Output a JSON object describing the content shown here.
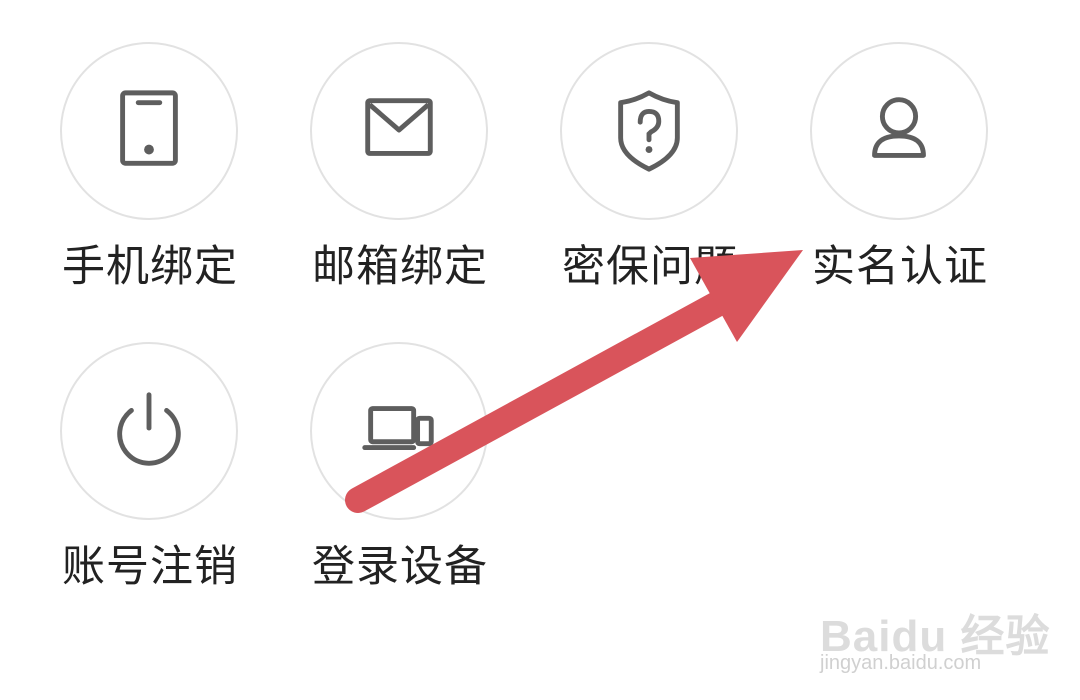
{
  "tiles": [
    {
      "label": "手机绑定",
      "icon": "phone-icon"
    },
    {
      "label": "邮箱绑定",
      "icon": "mail-icon"
    },
    {
      "label": "密保问题",
      "icon": "shield-question-icon"
    },
    {
      "label": "实名认证",
      "icon": "user-icon"
    },
    {
      "label": "账号注销",
      "icon": "power-icon"
    },
    {
      "label": "登录设备",
      "icon": "devices-icon"
    }
  ],
  "colors": {
    "icon_stroke": "#5e5e5e",
    "circle_border": "#e2e2e2",
    "arrow": "#d9545b",
    "label_text": "#222222"
  },
  "watermark": {
    "logo": "Baidu 经验",
    "url": "jingyan.baidu.com"
  }
}
